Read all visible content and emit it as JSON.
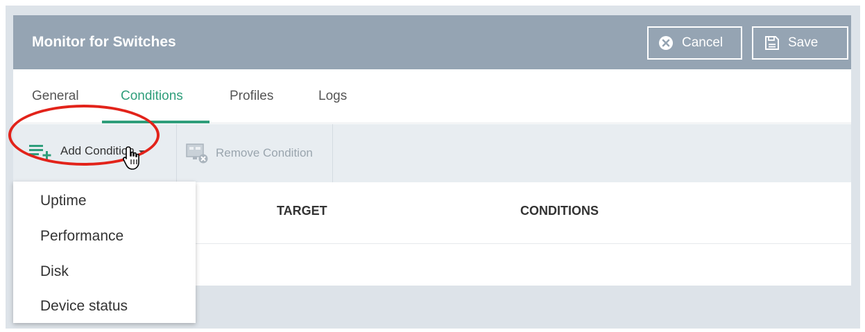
{
  "header": {
    "title": "Monitor for Switches",
    "cancel_label": "Cancel",
    "save_label": "Save"
  },
  "tabs": [
    {
      "label": "General",
      "active": false
    },
    {
      "label": "Conditions",
      "active": true
    },
    {
      "label": "Profiles",
      "active": false
    },
    {
      "label": "Logs",
      "active": false
    }
  ],
  "toolbar": {
    "add_condition_label": "Add Condition",
    "remove_condition_label": "Remove Condition"
  },
  "table": {
    "columns": [
      "TARGET",
      "CONDITIONS"
    ]
  },
  "add_condition_menu": {
    "items": [
      "Uptime",
      "Performance",
      "Disk",
      "Device status"
    ]
  },
  "colors": {
    "header_bg": "#95a4b3",
    "accent": "#2f9e7b",
    "highlight": "#e2231a",
    "toolbar_bg": "#e8edf1"
  },
  "icons": {
    "cancel": "close-circle-icon",
    "save": "floppy-disk-icon",
    "add_condition": "add-list-icon",
    "remove_condition": "remove-condition-icon",
    "cursor": "hand-pointer-icon"
  }
}
